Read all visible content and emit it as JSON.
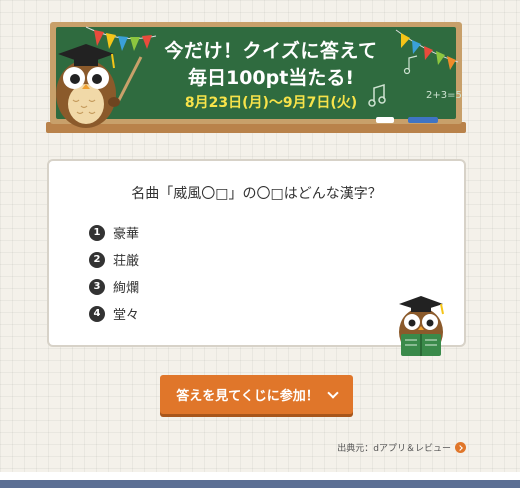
{
  "banner": {
    "line1": "今だけ！クイズに答えて",
    "line2": "毎日100pt当たる!",
    "dates": "8月23日(月)～9月7日(火)",
    "chalkboard_color": "#2f6b3f",
    "date_color": "#f7e34a",
    "chalk_math": "2+3=5"
  },
  "quiz": {
    "question": "名曲「威風〇□」の〇□はどんな漢字？",
    "options": [
      {
        "num": "1",
        "label": "豪華"
      },
      {
        "num": "2",
        "label": "荘厳"
      },
      {
        "num": "3",
        "label": "絢爛"
      },
      {
        "num": "4",
        "label": "堂々"
      }
    ]
  },
  "cta": {
    "label": "答えを見てくじに参加！",
    "color": "#e0762a"
  },
  "source": {
    "label": "出典元：dアプリ＆レビュー"
  },
  "footer": {
    "bar_color": "#5c6f94"
  }
}
